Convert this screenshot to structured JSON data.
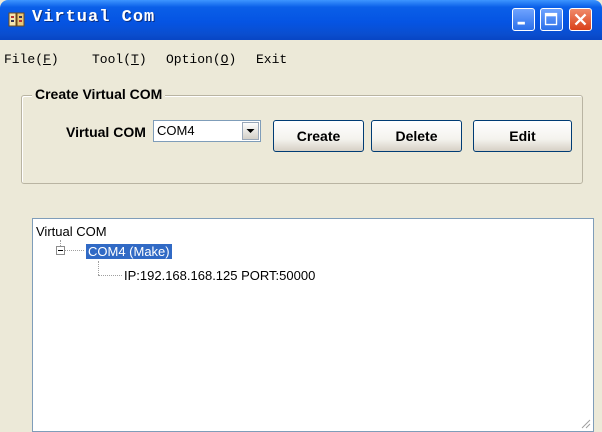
{
  "window": {
    "title": "Virtual Com"
  },
  "menu": [
    {
      "label": "File",
      "accel": "F"
    },
    {
      "label": "Tool",
      "accel": "T"
    },
    {
      "label": "Option",
      "accel": "O"
    },
    {
      "label": "Exit"
    }
  ],
  "create_group": {
    "legend": "Create Virtual COM",
    "virtual_com_label": "Virtual COM",
    "selected_com": "COM4",
    "buttons": {
      "create": "Create",
      "delete": "Delete",
      "edit": "Edit"
    }
  },
  "tree": {
    "root": "Virtual COM",
    "selected_node": "COM4 (Make)",
    "child": "IP:192.168.168.125  PORT:50000"
  },
  "colors": {
    "selection": "#316ac5",
    "title_bar": "#0554e3",
    "close_button": "#d9411a"
  }
}
